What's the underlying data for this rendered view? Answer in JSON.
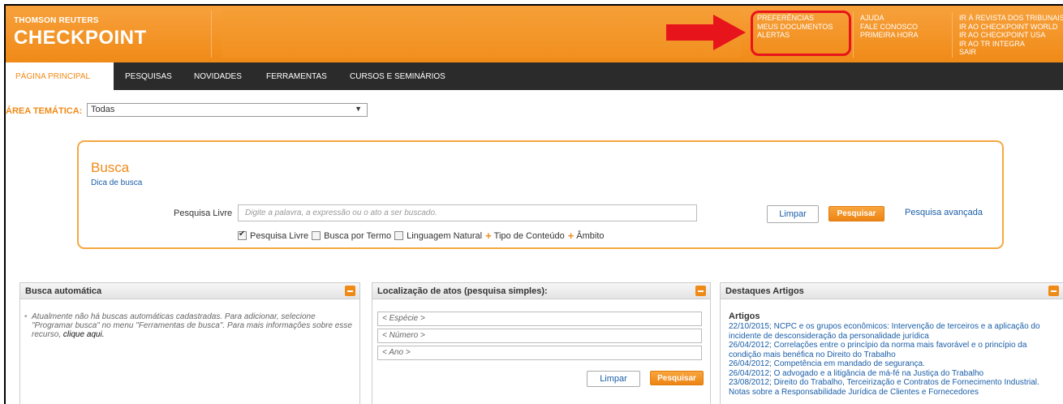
{
  "header": {
    "brand_small": "THOMSON REUTERS",
    "brand_big": "CHECKPOINT",
    "col1": [
      "PREFERÊNCIAS",
      "MEUS DOCUMENTOS",
      "ALERTAS"
    ],
    "col2": [
      "AJUDA",
      "FALE CONOSCO",
      "PRIMEIRA HORA"
    ],
    "col3": [
      "IR À REVISTA DOS TRIBUNAIS",
      "IR AO CHECKPOINT WORLD",
      "IR AO CHECKPOINT USA",
      "IR AO TR INTEGRA",
      "SAIR"
    ]
  },
  "nav": {
    "active": "PÁGINA PRINCIPAL",
    "items": [
      "PESQUISAS",
      "NOVIDADES",
      "FERRAMENTAS",
      "CURSOS E SEMINÁRIOS"
    ]
  },
  "area": {
    "label": "ÁREA TEMÁTICA:",
    "selected": "Todas"
  },
  "busca": {
    "title": "Busca",
    "tip": "Dica de busca",
    "field_label": "Pesquisa Livre",
    "placeholder": "Digite a palavra, a expressão ou o ato a ser buscado.",
    "limpar": "Limpar",
    "pesquisar": "Pesquisar",
    "avancada": "Pesquisa avançada",
    "options": {
      "livre": "Pesquisa Livre",
      "termo": "Busca por Termo",
      "natural": "Linguagem Natural",
      "tipo": "Tipo de Conteúdo",
      "ambito": "Âmbito"
    }
  },
  "panel_auto": {
    "title": "Busca automática",
    "text": "Atualmente não há buscas automáticas cadastradas. Para adicionar, selecione \"Programar busca\" no menu \"Ferramentas de busca\". Para mais informações sobre esse recurso,",
    "link": "clique aqui."
  },
  "panel_loc": {
    "title": "Localização de atos (pesquisa simples):",
    "especie": "< Espécie >",
    "numero": "< Número >",
    "ano": "< Ano >",
    "limpar": "Limpar",
    "pesquisar": "Pesquisar"
  },
  "panel_dest": {
    "title": "Destaques Artigos",
    "subtitle": "Artigos",
    "items": [
      "22/10/2015; NCPC e os grupos econômicos: Intervenção de terceiros e a aplicação do incidente de desconsideração da personalidade jurídica",
      "26/04/2012; Correlações entre o princípio da norma mais favorável e o princípio da condição mais benéfica no Direito do Trabalho",
      "26/04/2012; Competência em mandado de segurança.",
      "26/04/2012; O advogado e a litigância de má-fé na Justiça do Trabalho",
      "23/08/2012; Direito do Trabalho, Terceirização e Contratos de Fornecimento Industrial. Notas sobre a Responsabilidade Jurídica de Clientes e Fornecedores"
    ]
  },
  "colors": {
    "brand_orange": "#f08a17",
    "nav_dark": "#2b2b2b",
    "link_blue": "#1a5ea8",
    "annotation_red": "#e8141b"
  },
  "icons": [
    "arrow-annotation-icon",
    "checkbox-icon",
    "plus-icon",
    "collapse-icon",
    "dropdown-arrow-icon"
  ]
}
